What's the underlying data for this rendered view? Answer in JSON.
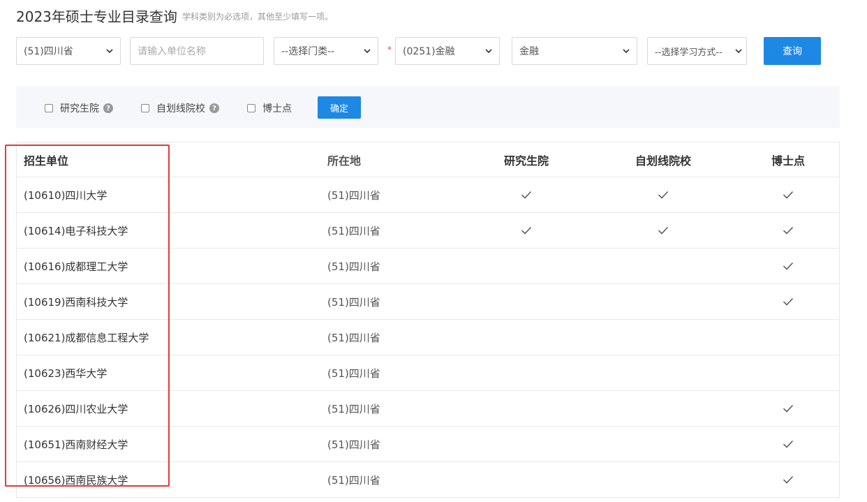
{
  "page": {
    "title": "2023年硕士专业目录查询",
    "subtitle": "学科类别为必选项，其他至少填写一项。"
  },
  "filters": {
    "province": "(51)四川省",
    "unit_placeholder": "请输入单位名称",
    "category": "--选择门类--",
    "required_mark": "*",
    "subject": "(0251)金融",
    "major": "金融",
    "study_mode": "--选择学习方式--",
    "query_label": "查询"
  },
  "options": {
    "graduate_school": "研究生院",
    "self_line": "自划线院校",
    "doctoral": "博士点",
    "help_glyph": "?",
    "confirm_label": "确定"
  },
  "table": {
    "headers": {
      "unit": "招生单位",
      "location": "所在地",
      "graduate_school": "研究生院",
      "self_line": "自划线院校",
      "doctoral": "博士点"
    },
    "rows": [
      {
        "unit": "(10610)四川大学",
        "location": "(51)四川省",
        "graduate_school": true,
        "self_line": true,
        "doctoral": true
      },
      {
        "unit": "(10614)电子科技大学",
        "location": "(51)四川省",
        "graduate_school": true,
        "self_line": true,
        "doctoral": true
      },
      {
        "unit": "(10616)成都理工大学",
        "location": "(51)四川省",
        "graduate_school": false,
        "self_line": false,
        "doctoral": true
      },
      {
        "unit": "(10619)西南科技大学",
        "location": "(51)四川省",
        "graduate_school": false,
        "self_line": false,
        "doctoral": true
      },
      {
        "unit": "(10621)成都信息工程大学",
        "location": "(51)四川省",
        "graduate_school": false,
        "self_line": false,
        "doctoral": false
      },
      {
        "unit": "(10623)西华大学",
        "location": "(51)四川省",
        "graduate_school": false,
        "self_line": false,
        "doctoral": false
      },
      {
        "unit": "(10626)四川农业大学",
        "location": "(51)四川省",
        "graduate_school": false,
        "self_line": false,
        "doctoral": true
      },
      {
        "unit": "(10651)西南财经大学",
        "location": "(51)四川省",
        "graduate_school": false,
        "self_line": false,
        "doctoral": true
      },
      {
        "unit": "(10656)西南民族大学",
        "location": "(51)四川省",
        "graduate_school": false,
        "self_line": false,
        "doctoral": true
      }
    ]
  },
  "colors": {
    "accent": "#1e88e5",
    "highlight": "#e53935"
  },
  "icons": {
    "check": "check-icon",
    "dropdown": "chevron-down-icon",
    "help": "help-icon"
  }
}
